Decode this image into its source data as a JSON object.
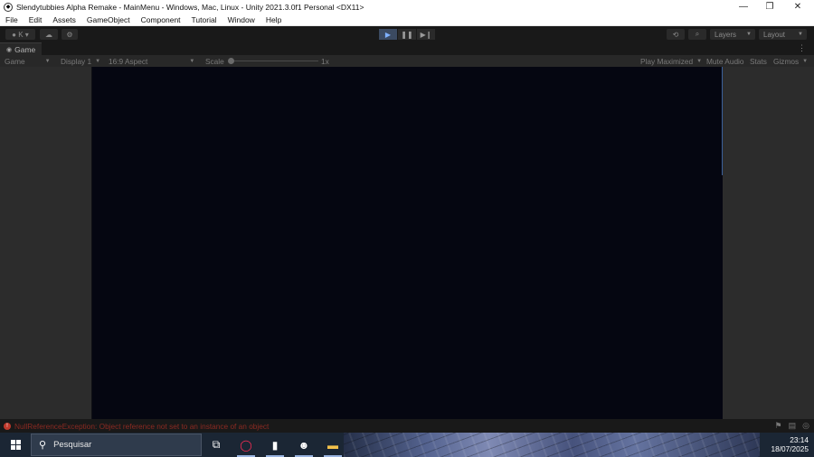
{
  "window": {
    "title": "Slendytubbies Alpha Remake - MainMenu - Windows, Mac, Linux - Unity 2021.3.0f1 Personal <DX11>",
    "controls": {
      "minimize": "—",
      "restore": "❐",
      "close": "✕"
    }
  },
  "menu": [
    "File",
    "Edit",
    "Assets",
    "GameObject",
    "Component",
    "Tutorial",
    "Window",
    "Help"
  ],
  "toolbar": {
    "account_label": "K",
    "layers_label": "Layers",
    "layout_label": "Layout"
  },
  "game_tab": {
    "label": "Game"
  },
  "game_toolbar": {
    "view_label": "Game",
    "display_label": "Display 1",
    "aspect_label": "16:9 Aspect",
    "scale_label": "Scale",
    "scale_value": "1x",
    "play_mode_label": "Play Maximized",
    "mute_label": "Mute Audio",
    "stats_label": "Stats",
    "gizmos_label": "Gizmos"
  },
  "status": {
    "message": "NullReferenceException: Object reference not set to an instance of an object"
  },
  "taskbar": {
    "search_placeholder": "Pesquisar",
    "time": "23:14",
    "date": "18/07/2025"
  },
  "colors": {
    "editor_bg": "#191919",
    "panel_bg": "#282828",
    "game_canvas": "#050611",
    "play_active": "#3b4a61",
    "error_red": "#c0392b"
  }
}
